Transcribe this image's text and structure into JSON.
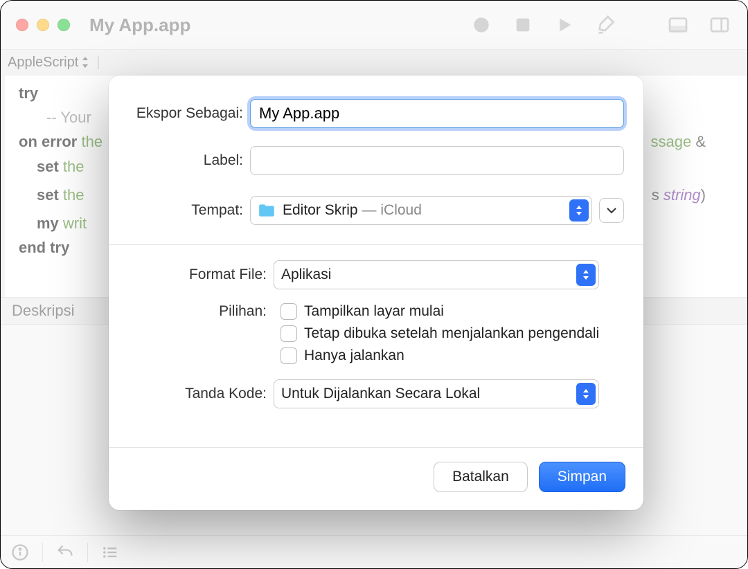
{
  "window": {
    "title": "My App.app",
    "language": "AppleScript"
  },
  "editor": {
    "line1_kw": "try",
    "line2_cm": "-- Your",
    "line3_kw": "on error",
    "line3_gr": " the",
    "line3_tail_gr": "ssage",
    "line3_tail_txt": " &",
    "line4a_kw": "set",
    "line4a_gr": " the",
    "line5a_kw": "set",
    "line5a_gr": " the",
    "line5_tail_txt": "s ",
    "line5_tail_pur": "string",
    "line5_tail_paren": ")",
    "line6_kw": "my",
    "line6_gr": " writ",
    "line7_kw": "end try"
  },
  "desc_bar": "Deskripsi",
  "dialog": {
    "export_as_label": "Ekspor Sebagai:",
    "export_as_value": "My App.app",
    "label_label": "Label:",
    "label_value": "",
    "where_label": "Tempat:",
    "where_folder": "Editor Skrip",
    "where_suffix": " — iCloud",
    "file_format_label": "Format File:",
    "file_format_value": "Aplikasi",
    "options_label": "Pilihan:",
    "opt1": "Tampilkan layar mulai",
    "opt2": "Tetap dibuka setelah menjalankan pengendali",
    "opt3": "Hanya jalankan",
    "code_sign_label": "Tanda Kode:",
    "code_sign_value": "Untuk Dijalankan Secara Lokal",
    "cancel": "Batalkan",
    "save": "Simpan"
  }
}
